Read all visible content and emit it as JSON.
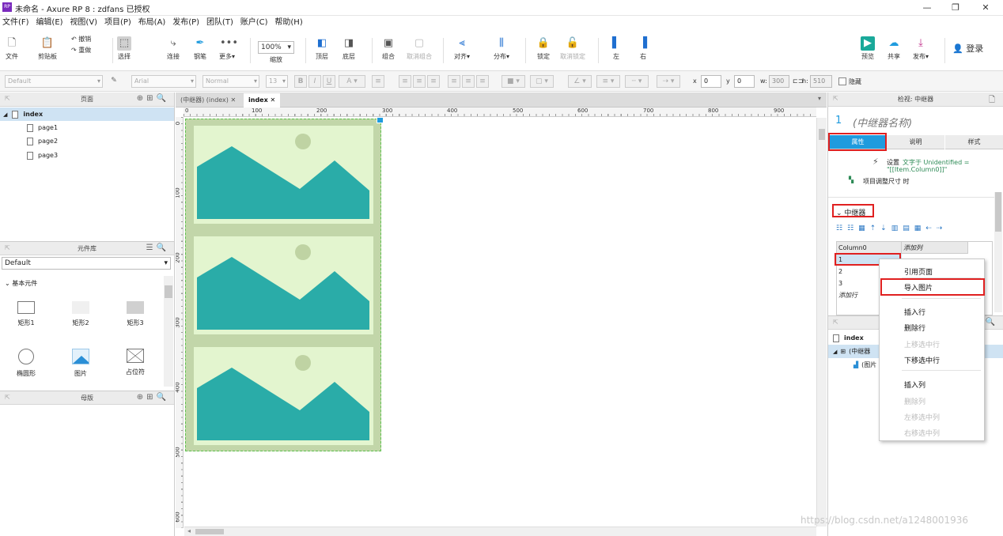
{
  "window": {
    "title": "未命名 - Axure RP 8 : zdfans 已授权",
    "app_icon": "RP"
  },
  "menu": [
    "文件(F)",
    "编辑(E)",
    "视图(V)",
    "项目(P)",
    "布局(A)",
    "发布(P)",
    "团队(T)",
    "账户(C)",
    "帮助(H)"
  ],
  "toolbar": {
    "file": "文件",
    "clipboard": "剪贴板",
    "undo": "撤销",
    "redo": "重做",
    "select": "选择",
    "connect": "连接",
    "pen": "钢笔",
    "more": "更多▾",
    "zoom_value": "100%",
    "zoom": "缩放",
    "top": "顶层",
    "bottom": "底层",
    "group": "组合",
    "ungroup": "取消组合",
    "align": "对齐▾",
    "distribute": "分布▾",
    "lock": "锁定",
    "unlock": "取消锁定",
    "left": "左",
    "right": "右",
    "preview": "预览",
    "share": "共享",
    "publish": "发布▾",
    "login": "登录"
  },
  "formatbar": {
    "style": "Default",
    "font": "Arial",
    "weight": "Normal",
    "size": "13",
    "x_label": "x",
    "x": "0",
    "y_label": "y",
    "y": "0",
    "w_label": "w:",
    "w": "300",
    "h_label": "h:",
    "h": "510",
    "hide": "隐藏"
  },
  "pages_panel": {
    "title": "页面",
    "root": "index",
    "pages": [
      "page1",
      "page2",
      "page3"
    ]
  },
  "library_panel": {
    "title": "元件库",
    "selected": "Default",
    "group": "基本元件",
    "widgets": [
      "矩形1",
      "矩形2",
      "矩形3",
      "椭圆形",
      "图片",
      "占位符"
    ]
  },
  "masters_panel": {
    "title": "母版"
  },
  "canvas": {
    "tabs": [
      "(中继器) (index)",
      "index"
    ],
    "ruler_h": [
      "0",
      "100",
      "200",
      "300",
      "400",
      "500",
      "600",
      "700",
      "800",
      "900"
    ],
    "ruler_v": [
      "0",
      "100",
      "200",
      "300",
      "400",
      "500",
      "600"
    ]
  },
  "inspector": {
    "title": "检视: 中继器",
    "number": "1",
    "name": "(中继器名称)",
    "tabs": [
      "属性",
      "说明",
      "样式"
    ],
    "interaction_prefix": "设置",
    "interaction_detail": "文字于 Unidentified =",
    "interaction_value": "\"[[Item.Column0]]\"",
    "interaction_2": "项目调整尺寸 时",
    "section": "中继器",
    "grid": {
      "headers": [
        "Column0",
        "添加列"
      ],
      "rows": [
        "1",
        "2",
        "3"
      ],
      "add_row": "添加行"
    }
  },
  "outline": {
    "root": "index",
    "repeater": "(中继器",
    "image": "(图片"
  },
  "context_menu": {
    "items": [
      {
        "label": "引用页面",
        "enabled": true
      },
      {
        "label": "导入图片",
        "enabled": true
      },
      {
        "label": "插入行",
        "enabled": true
      },
      {
        "label": "删除行",
        "enabled": true
      },
      {
        "label": "上移选中行",
        "enabled": false
      },
      {
        "label": "下移选中行",
        "enabled": true
      },
      {
        "label": "插入列",
        "enabled": true
      },
      {
        "label": "删除列",
        "enabled": false
      },
      {
        "label": "左移选中列",
        "enabled": false
      },
      {
        "label": "右移选中列",
        "enabled": false
      }
    ]
  },
  "watermark": "https://blog.csdn.net/a1248001936",
  "colors": {
    "accent": "#1f9bde",
    "highlight": "#e02020",
    "repeater_bg": "#c2d6a9",
    "image_bg": "#e3f5cf",
    "mountain": "#2aaca8"
  }
}
